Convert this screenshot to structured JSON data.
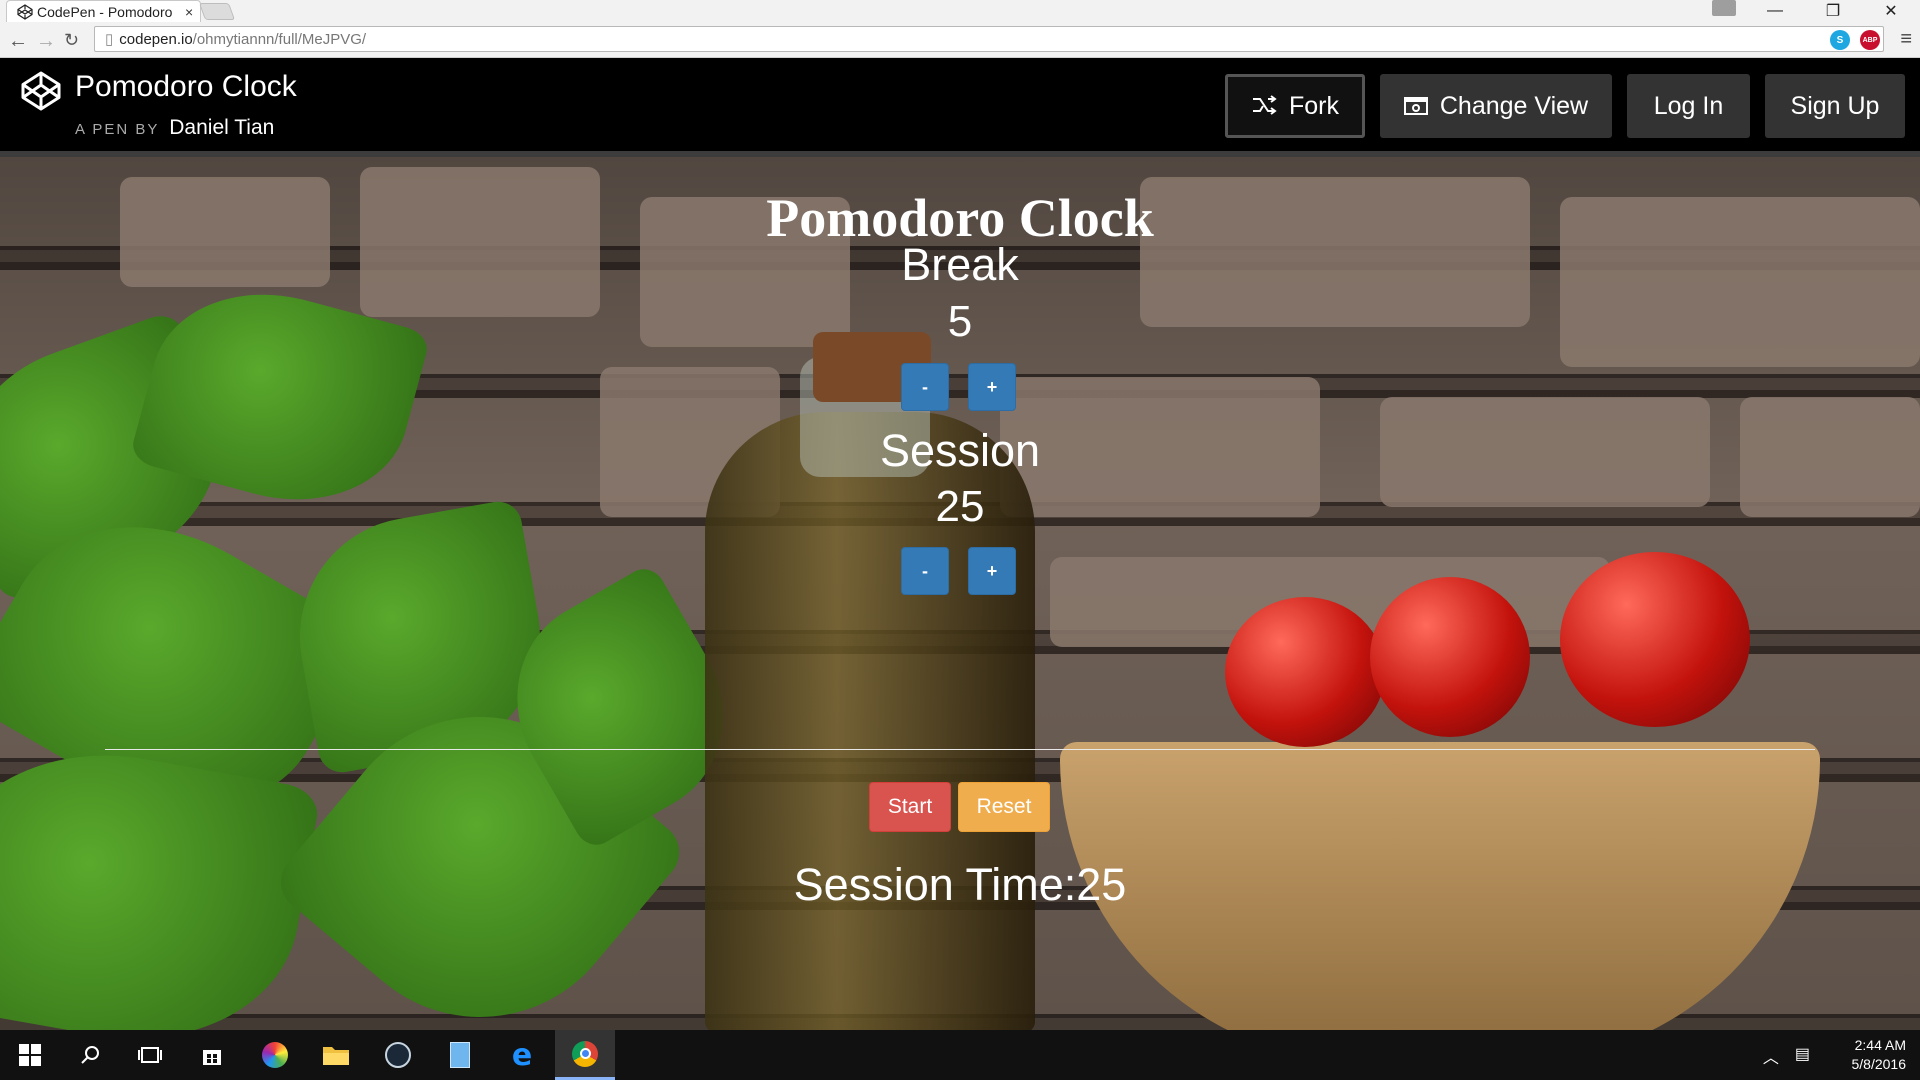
{
  "browser": {
    "tab_title": "CodePen - Pomodoro",
    "tab_close": "×",
    "url_host": "codepen.io",
    "url_path": "/ohmytiannn/full/MeJPVG/",
    "ext_abp": "ABP",
    "ext_skype": "S"
  },
  "codepen": {
    "pen_title": "Pomodoro Clock",
    "byline": "A PEN BY",
    "author": "Daniel Tian",
    "fork_label": "Fork",
    "change_view_label": "Change View",
    "login_label": "Log In",
    "signup_label": "Sign Up"
  },
  "app": {
    "title": "Pomodoro Clock",
    "break_label": "Break",
    "break_value": "5",
    "session_label": "Session",
    "session_value": "25",
    "minus": "-",
    "plus": "+",
    "start_label": "Start",
    "reset_label": "Reset",
    "session_time": "Session Time:25"
  },
  "taskbar": {
    "time": "2:44 AM",
    "date": "5/8/2016"
  },
  "colors": {
    "primary": "#337ab7",
    "danger": "#d9534f",
    "warning": "#f0ad4e"
  }
}
